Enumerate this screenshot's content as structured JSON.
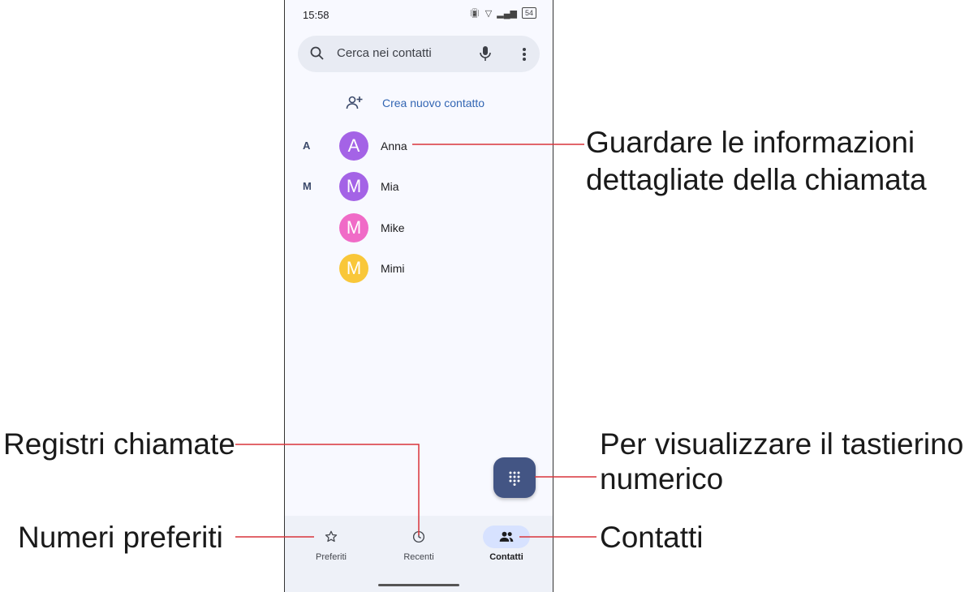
{
  "status_bar": {
    "time": "15:58",
    "battery": "54"
  },
  "search": {
    "placeholder": "Cerca nei contatti"
  },
  "create_contact": {
    "label": "Crea nuovo contatto"
  },
  "contacts": [
    {
      "section": "A",
      "initial": "A",
      "name": "Anna",
      "color": "#a463e6"
    },
    {
      "section": "M",
      "initial": "M",
      "name": "Mia",
      "color": "#a463e6"
    },
    {
      "section": "",
      "initial": "M",
      "name": "Mike",
      "color": "#f06bc7"
    },
    {
      "section": "",
      "initial": "M",
      "name": "Mimi",
      "color": "#f9c739"
    }
  ],
  "bottom_nav": {
    "favorites": "Preferiti",
    "recents": "Recenti",
    "contacts": "Contatti",
    "active": "contacts"
  },
  "callouts": {
    "details_line1": "Guardare le informazioni",
    "details_line2": "dettagliate della chiamata",
    "call_log": "Registri chiamate",
    "keypad_line1": "Per visualizzare il tastierino",
    "keypad_line2": "numerico",
    "favorites": "Numeri preferiti",
    "contacts": "Contatti"
  },
  "colors": {
    "accent": "#435584",
    "callout_line": "#d9343a",
    "link": "#3366b3"
  }
}
